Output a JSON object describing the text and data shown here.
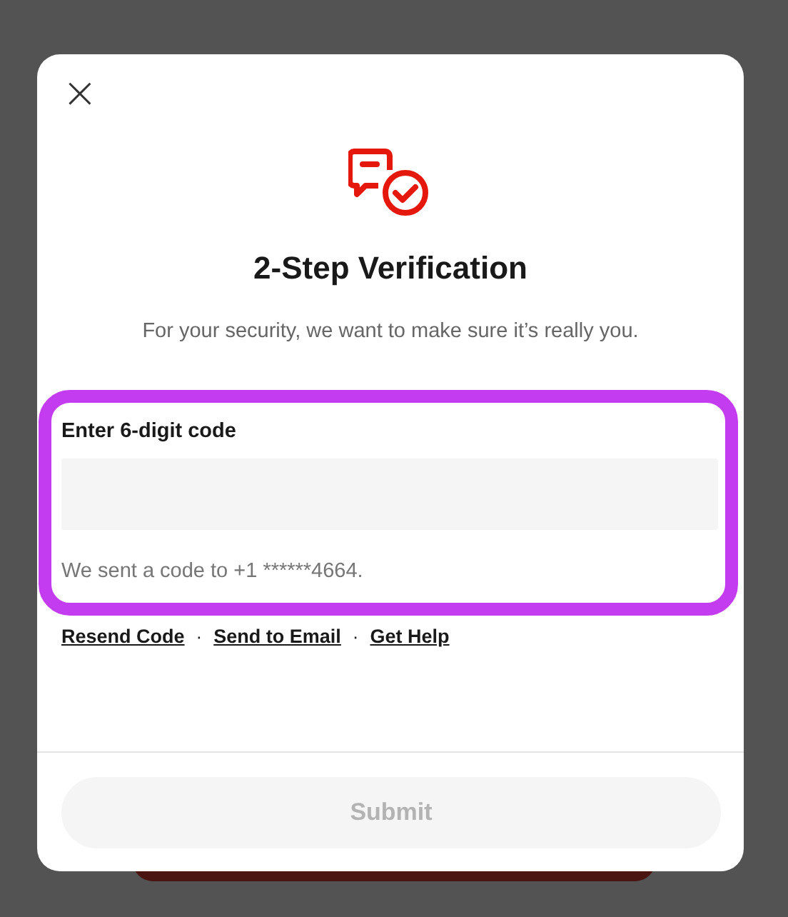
{
  "dialog": {
    "close": "×",
    "title": "2-Step Verification",
    "subtitle": "For your security, we want to make sure it’s really you.",
    "code_field": {
      "label": "Enter 6-digit code",
      "helper": "We sent a code to +1 ******4664."
    },
    "links": [
      {
        "label": "Resend Code"
      },
      {
        "label": "Send to Email"
      },
      {
        "label": "Get Help"
      }
    ],
    "separator": "·",
    "submit": {
      "label": "Submit",
      "disabled": true
    }
  }
}
